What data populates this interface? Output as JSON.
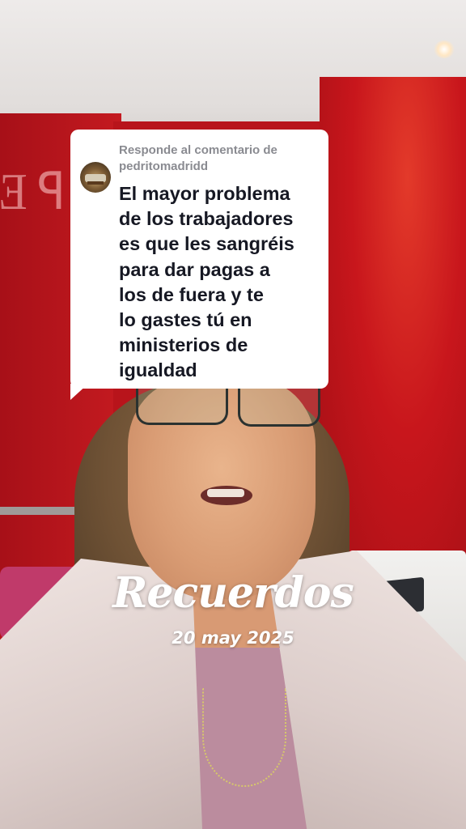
{
  "reply": {
    "header": "Responde al comentario de pedritomadridd",
    "comment": "El mayor problema\nde los trabajadores\nes que les sangréis\npara dar pagas a\nlos de fuera y te\nlo gastes tú en\nministerios de\nigualdad",
    "avatar_icon": "user-avatar-car"
  },
  "overlay": {
    "title": "Recuerdos",
    "date": "20 may 2025"
  },
  "colors": {
    "wall": "#b8141b",
    "bubble": "#ffffff",
    "header_text": "#8a8b91",
    "comment_text": "#161823"
  }
}
